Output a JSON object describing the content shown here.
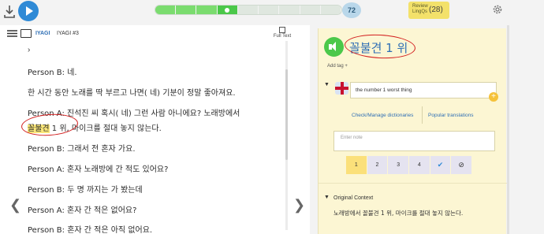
{
  "topbar": {
    "progress_segments": 9,
    "progress_filled": 4,
    "page_count": "72",
    "review_label": "Review LingQs",
    "review_count": "(28)"
  },
  "reader": {
    "course": "IYAGI",
    "lesson": "IYAGI #3",
    "full_text": "Full Text",
    "lines": [
      "Person B: 네.",
      "한 시간 동안 노래를 딱 부르고 나면( 네) 기분이 정말 좋아져요.",
      "Person A: 진석진 씨 혹시( 네) 그런 사람 아니에요? 노래방에서",
      "1 위, 마이크를 절대 놓지 않는다.",
      "Person B: 그래서 전 혼자 가요.",
      "Person A: 혼자 노래방에 간 적도 있어요?",
      "Person B: 두 명 까지는 가 봤는데",
      "Person A: 혼자 간 적은 없어요?",
      "Person B: 혼자 간 적은 아직 없어요."
    ],
    "highlight_word": "꼴불견"
  },
  "panel": {
    "term": "꼴불견 1 위",
    "add_tag": "Add tag +",
    "meaning": "the number 1 worst thing",
    "check_dicts": "Check/Manage dictionaries",
    "popular": "Popular translations",
    "note_placeholder": "Enter note",
    "statuses": [
      "1",
      "2",
      "3",
      "4",
      "✔",
      "⊘"
    ],
    "selected_status": "1",
    "context_title": "Original Context",
    "context_text": "노래방에서 꼴불견 1 위, 마이크를 절대 놓지 않는다."
  },
  "colors": {
    "accent_blue": "#2f6fb5",
    "progress_green": "#7bdc6f",
    "highlight_yellow": "#fbe77a",
    "panel_bg": "#fcf6d3",
    "annotation_red": "#d32020"
  }
}
